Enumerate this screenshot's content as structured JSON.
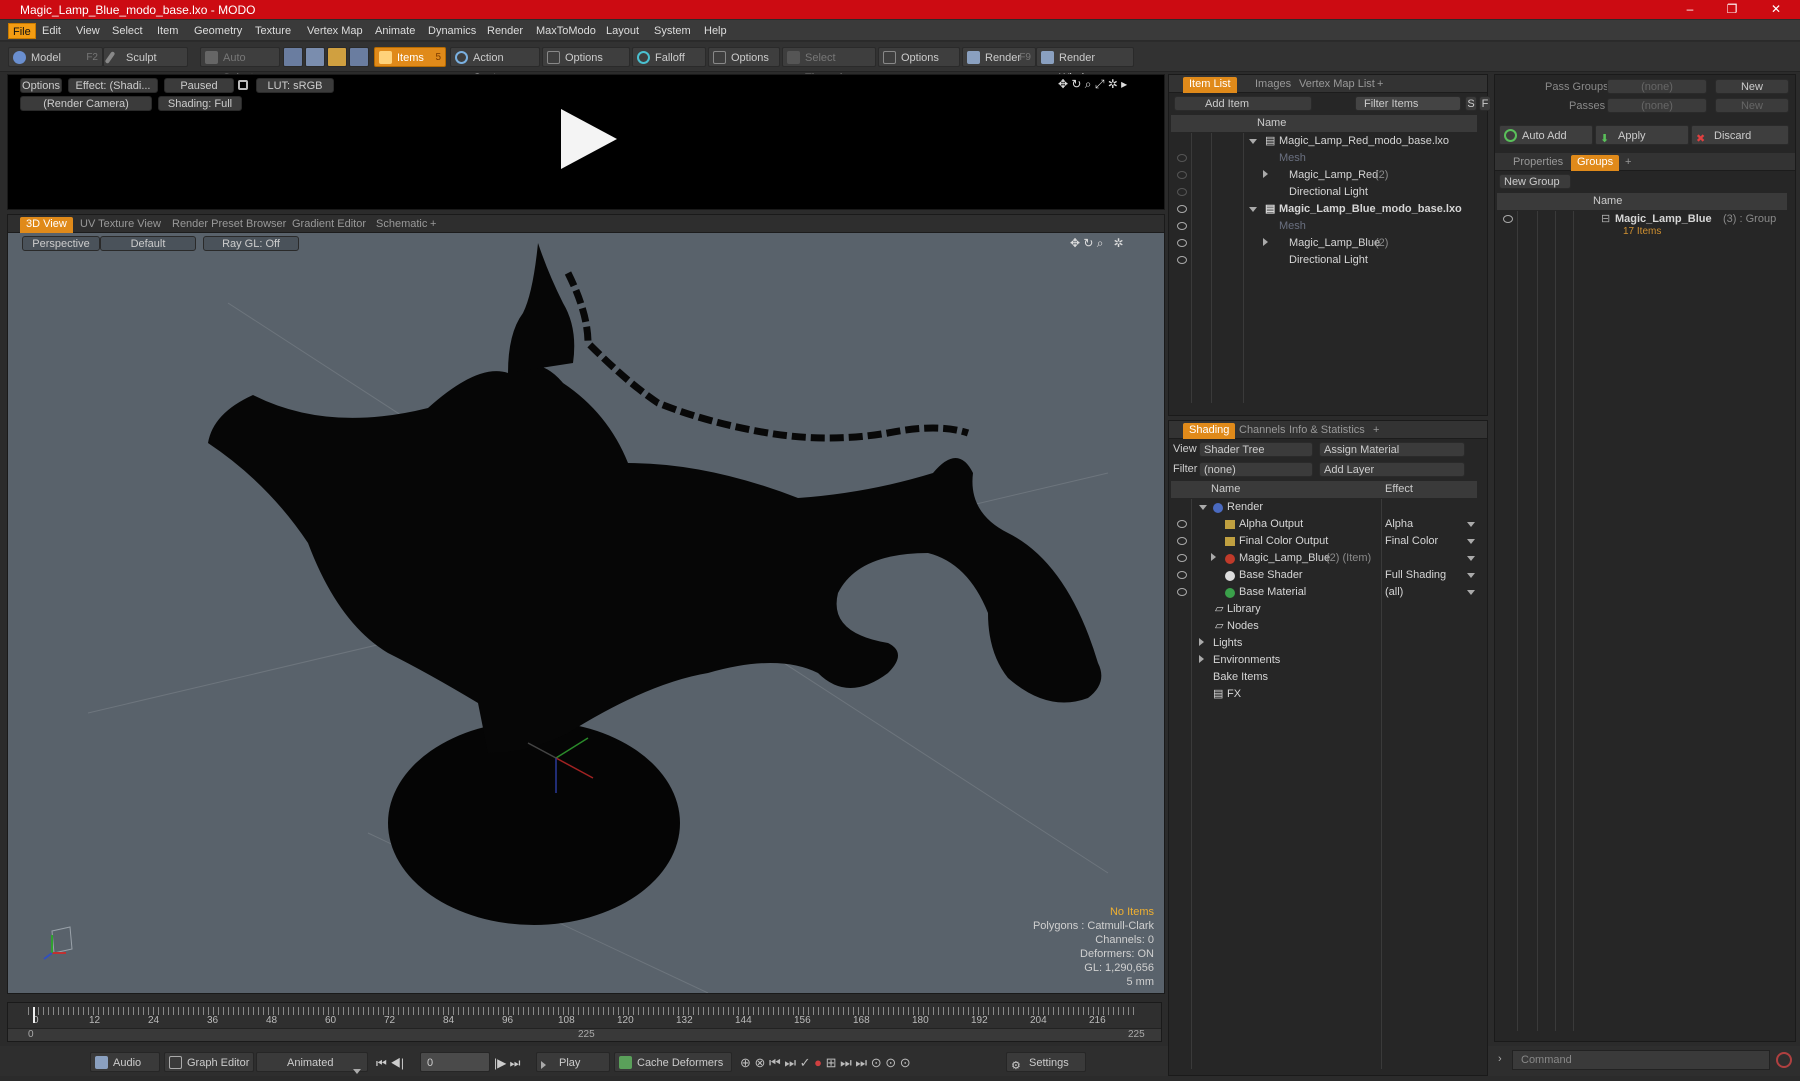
{
  "window": {
    "title": "Magic_Lamp_Blue_modo_base.lxo - MODO",
    "min": "–",
    "max": "❐",
    "close": "✕"
  },
  "menu": [
    "File",
    "Edit",
    "View",
    "Select",
    "Item",
    "Geometry",
    "Texture",
    "Vertex Map",
    "Animate",
    "Dynamics",
    "Render",
    "MaxToModo",
    "Layout",
    "System",
    "Help"
  ],
  "toolbar": {
    "model": "Model",
    "model_key": "F2",
    "sculpt": "Sculpt",
    "auto_select": "Auto Select",
    "items": "Items",
    "items_key": "5",
    "action_center": "Action Center",
    "options1": "Options",
    "falloff": "Falloff",
    "options2": "Options",
    "select_through": "Select Through",
    "options3": "Options",
    "render": "Render",
    "render_key": "F9",
    "render_window": "Render Window"
  },
  "preview": {
    "options": "Options",
    "effect": "Effect: (Shadi...",
    "paused": "Paused",
    "lut": "LUT: sRGB",
    "camera": "(Render Camera)",
    "shading": "Shading: Full"
  },
  "viewport": {
    "tabs": [
      "3D View",
      "UV Texture View",
      "Render Preset Browser",
      "Gradient Editor",
      "Schematic",
      "+"
    ],
    "perspective": "Perspective",
    "default": "Default",
    "raygl": "Ray GL: Off",
    "stats": {
      "no_items": "No Items",
      "polygons": "Polygons : Catmull-Clark",
      "channels": "Channels: 0",
      "deformers": "Deformers: ON",
      "gl": "GL: 1,290,656",
      "scale": "5 mm"
    }
  },
  "timeline": {
    "ticks": [
      "0",
      "12",
      "24",
      "36",
      "48",
      "60",
      "72",
      "84",
      "96",
      "108",
      "120",
      "132",
      "144",
      "156",
      "168",
      "180",
      "192",
      "204",
      "216"
    ],
    "start": "0",
    "mid": "225",
    "end": "225"
  },
  "bottom": {
    "audio": "Audio",
    "graph_editor": "Graph Editor",
    "animated": "Animated",
    "frame": "0",
    "play": "Play",
    "cache": "Cache Deformers",
    "settings": "Settings"
  },
  "itemlist": {
    "tabs": [
      "Item List",
      "Images",
      "Vertex Map List",
      "+"
    ],
    "add_item": "Add Item",
    "filter": "Filter Items",
    "s": "S",
    "f": "F",
    "name_hdr": "Name",
    "rows": [
      {
        "label": "Magic_Lamp_Red_modo_base.lxo",
        "extra": ""
      },
      {
        "label": "Mesh",
        "extra": ""
      },
      {
        "label": "Magic_Lamp_Red",
        "extra": "(2)"
      },
      {
        "label": "Directional Light",
        "extra": ""
      },
      {
        "label": "Magic_Lamp_Blue_modo_base.lxo",
        "extra": ""
      },
      {
        "label": "Mesh",
        "extra": ""
      },
      {
        "label": "Magic_Lamp_Blue",
        "extra": "(2)"
      },
      {
        "label": "Directional Light",
        "extra": ""
      }
    ]
  },
  "shading": {
    "tabs": [
      "Shading",
      "Channels",
      "Info & Statistics",
      "+"
    ],
    "view_label": "View",
    "view_value": "Shader Tree",
    "assign": "Assign Material",
    "filter_label": "Filter",
    "filter_value": "(none)",
    "add_layer": "Add Layer",
    "name_hdr": "Name",
    "effect_hdr": "Effect",
    "rows": [
      {
        "label": "Render",
        "extra": "",
        "effect": ""
      },
      {
        "label": "Alpha Output",
        "extra": "",
        "effect": "Alpha"
      },
      {
        "label": "Final Color Output",
        "extra": "",
        "effect": "Final Color"
      },
      {
        "label": "Magic_Lamp_Blue",
        "extra": "(2) (Item)",
        "effect": ""
      },
      {
        "label": "Base Shader",
        "extra": "",
        "effect": "Full Shading"
      },
      {
        "label": "Base Material",
        "extra": "",
        "effect": "(all)"
      },
      {
        "label": "Library",
        "extra": "",
        "effect": ""
      },
      {
        "label": "Nodes",
        "extra": "",
        "effect": ""
      },
      {
        "label": "Lights",
        "extra": "",
        "effect": ""
      },
      {
        "label": "Environments",
        "extra": "",
        "effect": ""
      },
      {
        "label": "Bake Items",
        "extra": "",
        "effect": ""
      },
      {
        "label": "FX",
        "extra": "",
        "effect": ""
      }
    ]
  },
  "groups": {
    "pass_groups": "Pass Groups",
    "pass_value": "(none)",
    "new": "New",
    "passes": "Passes",
    "passes_value": "(none)",
    "new2": "New",
    "auto_add": "Auto Add",
    "apply": "Apply",
    "discard": "Discard",
    "tabs": [
      "Properties",
      "Groups",
      "+"
    ],
    "new_group": "New Group",
    "name_hdr": "Name",
    "group_name": "Magic_Lamp_Blue",
    "group_extra": "(3) : Group",
    "group_count": "17 Items"
  },
  "command": {
    "placeholder": "Command"
  }
}
